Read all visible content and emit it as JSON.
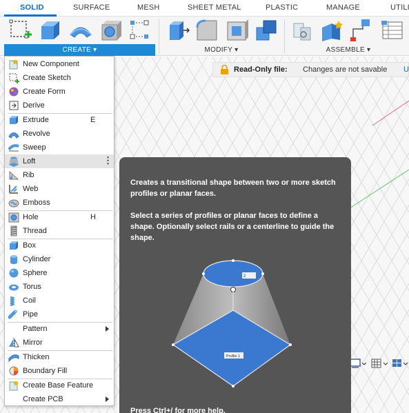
{
  "tabs": [
    {
      "label": "SOLID"
    },
    {
      "label": "SURFACE"
    },
    {
      "label": "MESH"
    },
    {
      "label": "SHEET METAL"
    },
    {
      "label": "PLASTIC"
    },
    {
      "label": "MANAGE"
    },
    {
      "label": "UTILI"
    }
  ],
  "ribbon": {
    "create_label": "CREATE ▾",
    "modify_label": "MODIFY ▾",
    "assemble_label": "ASSEMBLE ▾"
  },
  "notice": {
    "title": "Read-Only file:",
    "message": "Changes are not savable",
    "extra": "U"
  },
  "menu": {
    "items": [
      {
        "label": "New Component",
        "key": "",
        "icon": "new-component-icon"
      },
      {
        "label": "Create Sketch",
        "key": "",
        "icon": "create-sketch-icon"
      },
      {
        "label": "Create Form",
        "key": "",
        "icon": "create-form-icon"
      },
      {
        "label": "Derive",
        "key": "",
        "icon": "derive-icon"
      },
      {
        "label": "Extrude",
        "key": "E",
        "icon": "extrude-icon"
      },
      {
        "label": "Revolve",
        "key": "",
        "icon": "revolve-icon"
      },
      {
        "label": "Sweep",
        "key": "",
        "icon": "sweep-icon"
      },
      {
        "label": "Loft",
        "key": "",
        "icon": "loft-icon"
      },
      {
        "label": "Rib",
        "key": "",
        "icon": "rib-icon"
      },
      {
        "label": "Web",
        "key": "",
        "icon": "web-icon"
      },
      {
        "label": "Emboss",
        "key": "",
        "icon": "emboss-icon"
      },
      {
        "label": "Hole",
        "key": "H",
        "icon": "hole-icon"
      },
      {
        "label": "Thread",
        "key": "",
        "icon": "thread-icon"
      },
      {
        "label": "Box",
        "key": "",
        "icon": "box-icon"
      },
      {
        "label": "Cylinder",
        "key": "",
        "icon": "cylinder-icon"
      },
      {
        "label": "Sphere",
        "key": "",
        "icon": "sphere-icon"
      },
      {
        "label": "Torus",
        "key": "",
        "icon": "torus-icon"
      },
      {
        "label": "Coil",
        "key": "",
        "icon": "coil-icon"
      },
      {
        "label": "Pipe",
        "key": "",
        "icon": "pipe-icon"
      },
      {
        "label": "Pattern",
        "key": "",
        "icon": ""
      },
      {
        "label": "Mirror",
        "key": "",
        "icon": "mirror-icon"
      },
      {
        "label": "Thicken",
        "key": "",
        "icon": "thicken-icon"
      },
      {
        "label": "Boundary Fill",
        "key": "",
        "icon": "boundary-fill-icon"
      },
      {
        "label": "Create Base Feature",
        "key": "",
        "icon": "base-feature-icon"
      },
      {
        "label": "Create PCB",
        "key": "",
        "icon": ""
      }
    ]
  },
  "tooltip": {
    "paragraph1": "Creates a transitional shape between two or more sketch profiles or planar faces.",
    "paragraph2": "Select a series of profiles or planar faces to define a shape. Optionally select rails or a centerline to guide the shape.",
    "help": "Press Ctrl+/ for more help.",
    "profile_label": "Profile 1",
    "profile2_label": "2"
  },
  "colors": {
    "accent": "#1d8ad7",
    "tab_active": "#0a6fc9",
    "tooltip_bg": "#555555",
    "body_blue": "#3b78d0"
  }
}
